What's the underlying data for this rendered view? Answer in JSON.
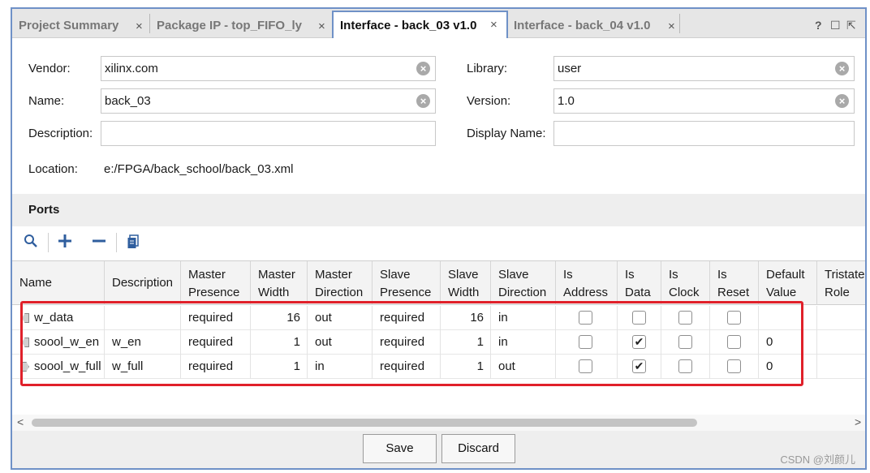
{
  "tabs": [
    {
      "label": "Project Summary",
      "close": "×"
    },
    {
      "label": "Package IP - top_FIFO_ly",
      "close": "×"
    },
    {
      "label": "Interface - back_03 v1.0",
      "close": "×"
    },
    {
      "label": "Interface - back_04 v1.0",
      "close": "×"
    }
  ],
  "window_controls": {
    "help": "?",
    "restore": "☐",
    "float": "⇱"
  },
  "form": {
    "vendor_label": "Vendor:",
    "vendor_value": "xilinx.com",
    "name_label": "Name:",
    "name_value": "back_03",
    "description_label": "Description:",
    "description_value": "",
    "location_label": "Location:",
    "location_value": "e:/FPGA/back_school/back_03.xml",
    "library_label": "Library:",
    "library_value": "user",
    "version_label": "Version:",
    "version_value": "1.0",
    "display_name_label": "Display Name:",
    "display_name_value": ""
  },
  "ports": {
    "title": "Ports",
    "columns": [
      "Name",
      "Description",
      "Master Presence",
      "Master Width",
      "Master Direction",
      "Slave Presence",
      "Slave Width",
      "Slave Direction",
      "Is Address",
      "Is Data",
      "Is Clock",
      "Is Reset",
      "Default Value",
      "Tristate Role"
    ],
    "rows": [
      {
        "name": "w_data",
        "description": "",
        "master_presence": "required",
        "master_width": "16",
        "master_direction": "out",
        "slave_presence": "required",
        "slave_width": "16",
        "slave_direction": "in",
        "is_address": false,
        "is_data": false,
        "is_clock": false,
        "is_reset": false,
        "default_value": "",
        "tristate_role": "",
        "icon": "port-in-icon"
      },
      {
        "name": "soool_w_en",
        "description": "w_en",
        "master_presence": "required",
        "master_width": "1",
        "master_direction": "out",
        "slave_presence": "required",
        "slave_width": "1",
        "slave_direction": "in",
        "is_address": false,
        "is_data": true,
        "is_clock": false,
        "is_reset": false,
        "default_value": "0",
        "tristate_role": "",
        "icon": "port-in-icon"
      },
      {
        "name": "soool_w_full",
        "description": "w_full",
        "master_presence": "required",
        "master_width": "1",
        "master_direction": "in",
        "slave_presence": "required",
        "slave_width": "1",
        "slave_direction": "out",
        "is_address": false,
        "is_data": true,
        "is_clock": false,
        "is_reset": false,
        "default_value": "0",
        "tristate_role": "",
        "icon": "port-out-icon"
      }
    ],
    "highlight_color": "#e0202a"
  },
  "buttons": {
    "save": "Save",
    "discard": "Discard"
  },
  "watermark": "CSDN @刘颜儿",
  "colors": {
    "accent": "#6f91c7",
    "toolbar_icon": "#2f5e9e"
  }
}
